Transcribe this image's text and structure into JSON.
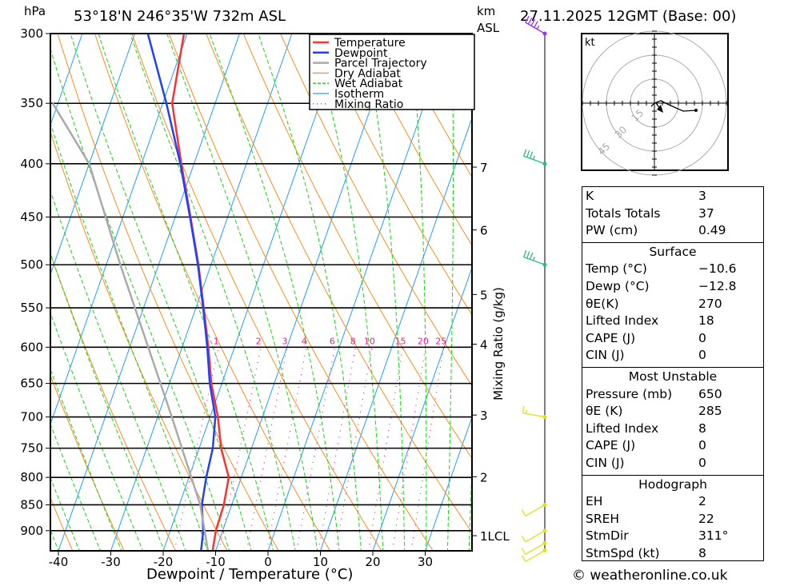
{
  "header": {
    "pressure_unit": "hPa",
    "location": "53°18'N  246°35'W  732m  ASL",
    "height_unit": "km",
    "height_ref": "ASL",
    "datetime": "27.11.2025  12GMT  (Base: 00)"
  },
  "legend": [
    {
      "label": "Temperature",
      "color": "#ff3030",
      "style": "solid"
    },
    {
      "label": "Dewpoint",
      "color": "#2040ff",
      "style": "solid"
    },
    {
      "label": "Parcel Trajectory",
      "color": "#aaaaaa",
      "style": "solid"
    },
    {
      "label": "Dry Adiabat",
      "color": "#ff8c1a",
      "style": "solid"
    },
    {
      "label": "Wet Adiabat",
      "color": "#19d419",
      "style": "dashed"
    },
    {
      "label": "Isotherm",
      "color": "#1ea0ff",
      "style": "solid"
    },
    {
      "label": "Mixing Ratio",
      "color": "#ff1493",
      "style": "dotted"
    }
  ],
  "chart_data": {
    "type": "line",
    "subtype": "skew-T log-P",
    "xlabel": "Dewpoint / Temperature (°C)",
    "ylabel": "hPa",
    "y2label": "Mixing Ratio (g/kg)",
    "x_ticks": [
      "-40",
      "-30",
      "-20",
      "-10",
      "0",
      "10",
      "20",
      "30"
    ],
    "y_ticks": [
      "300",
      "350",
      "400",
      "450",
      "500",
      "550",
      "600",
      "650",
      "700",
      "750",
      "800",
      "850",
      "900"
    ],
    "y_scale": "log",
    "km_ticks": [
      {
        "label": "7",
        "p": 403
      },
      {
        "label": "6",
        "p": 463
      },
      {
        "label": "5",
        "p": 534
      },
      {
        "label": "4",
        "p": 596
      },
      {
        "label": "3",
        "p": 697
      },
      {
        "label": "2",
        "p": 799
      },
      {
        "label": "1LCL",
        "p": 910
      }
    ],
    "mixing_ratio_labels": [
      "1",
      "2",
      "3",
      "4",
      "6",
      "8",
      "10",
      "15",
      "20",
      "25"
    ],
    "hodo_ring_labels": [
      "15",
      "30",
      "45"
    ],
    "hodo_unit": "kt",
    "series": [
      {
        "name": "Temperature",
        "color": "#ff3030",
        "points": [
          {
            "p": 940,
            "t": -10.6
          },
          {
            "p": 900,
            "t": -11.3
          },
          {
            "p": 850,
            "t": -11.5
          },
          {
            "p": 800,
            "t": -12.4
          },
          {
            "p": 750,
            "t": -15.8
          },
          {
            "p": 700,
            "t": -18.5
          },
          {
            "p": 650,
            "t": -22.0
          },
          {
            "p": 600,
            "t": -25.0
          },
          {
            "p": 550,
            "t": -28.5
          },
          {
            "p": 500,
            "t": -32.4
          },
          {
            "p": 450,
            "t": -37.1
          },
          {
            "p": 400,
            "t": -42.4
          },
          {
            "p": 350,
            "t": -48.2
          },
          {
            "p": 300,
            "t": -50.6
          }
        ]
      },
      {
        "name": "Dewpoint",
        "color": "#2040ff",
        "points": [
          {
            "p": 940,
            "t": -12.8
          },
          {
            "p": 900,
            "t": -13.7
          },
          {
            "p": 850,
            "t": -15.7
          },
          {
            "p": 800,
            "t": -16.7
          },
          {
            "p": 750,
            "t": -17.4
          },
          {
            "p": 700,
            "t": -19.0
          },
          {
            "p": 650,
            "t": -22.3
          },
          {
            "p": 600,
            "t": -25.2
          },
          {
            "p": 550,
            "t": -28.6
          },
          {
            "p": 500,
            "t": -32.5
          },
          {
            "p": 450,
            "t": -37.2
          },
          {
            "p": 400,
            "t": -42.6
          },
          {
            "p": 350,
            "t": -49.3
          },
          {
            "p": 300,
            "t": -57.5
          }
        ]
      },
      {
        "name": "Parcel Trajectory",
        "color": "#aaaaaa",
        "points": [
          {
            "p": 940,
            "t": -11.5
          },
          {
            "p": 850,
            "t": -16.0
          },
          {
            "p": 700,
            "t": -27.3
          },
          {
            "p": 500,
            "t": -47.3
          },
          {
            "p": 400,
            "t": -60.0
          },
          {
            "p": 350,
            "t": -71.0
          }
        ]
      }
    ],
    "wind_barbs": [
      {
        "p": 300,
        "color": "#9b30ff",
        "dir": 300,
        "kt": 35
      },
      {
        "p": 400,
        "color": "#20c080",
        "dir": 290,
        "kt": 25
      },
      {
        "p": 500,
        "color": "#20c080",
        "dir": 290,
        "kt": 25
      },
      {
        "p": 700,
        "color": "#e0e020",
        "dir": 280,
        "kt": 5
      },
      {
        "p": 850,
        "color": "#e0e020",
        "dir": 240,
        "kt": 10
      },
      {
        "p": 900,
        "color": "#e0e020",
        "dir": 240,
        "kt": 10
      },
      {
        "p": 925,
        "color": "#e0e020",
        "dir": 240,
        "kt": 10
      },
      {
        "p": 940,
        "color": "#e0e020",
        "dir": 240,
        "kt": 10
      }
    ],
    "hodograph_kt": [
      [
        -2,
        -2
      ],
      [
        0,
        0
      ],
      [
        4,
        1.5
      ],
      [
        9,
        -1
      ],
      [
        18,
        -5
      ],
      [
        26,
        -4.5
      ]
    ],
    "storm_motion_kt": [
      4,
      -4
    ]
  },
  "indices": {
    "general": [
      {
        "label": "K",
        "value": "3"
      },
      {
        "label": "Totals Totals",
        "value": "37"
      },
      {
        "label": "PW (cm)",
        "value": "0.49"
      }
    ],
    "surface": {
      "title": "Surface",
      "rows": [
        {
          "label": "Temp (°C)",
          "value": "−10.6"
        },
        {
          "label": "Dewp (°C)",
          "value": "−12.8"
        },
        {
          "label": "θE(K)",
          "value": "270"
        },
        {
          "label": "Lifted Index",
          "value": "18"
        },
        {
          "label": "CAPE (J)",
          "value": "0"
        },
        {
          "label": "CIN (J)",
          "value": "0"
        }
      ]
    },
    "most_unstable": {
      "title": "Most Unstable",
      "rows": [
        {
          "label": "Pressure (mb)",
          "value": "650"
        },
        {
          "label": "θE (K)",
          "value": "285"
        },
        {
          "label": "Lifted Index",
          "value": "8"
        },
        {
          "label": "CAPE (J)",
          "value": "0"
        },
        {
          "label": "CIN (J)",
          "value": "0"
        }
      ]
    },
    "hodograph": {
      "title": "Hodograph",
      "rows": [
        {
          "label": "EH",
          "value": "2"
        },
        {
          "label": "SREH",
          "value": "22"
        },
        {
          "label": "StmDir",
          "value": "311°"
        },
        {
          "label": "StmSpd (kt)",
          "value": "8"
        }
      ]
    }
  },
  "footer": {
    "copyright": "© weatheronline.co.uk"
  }
}
